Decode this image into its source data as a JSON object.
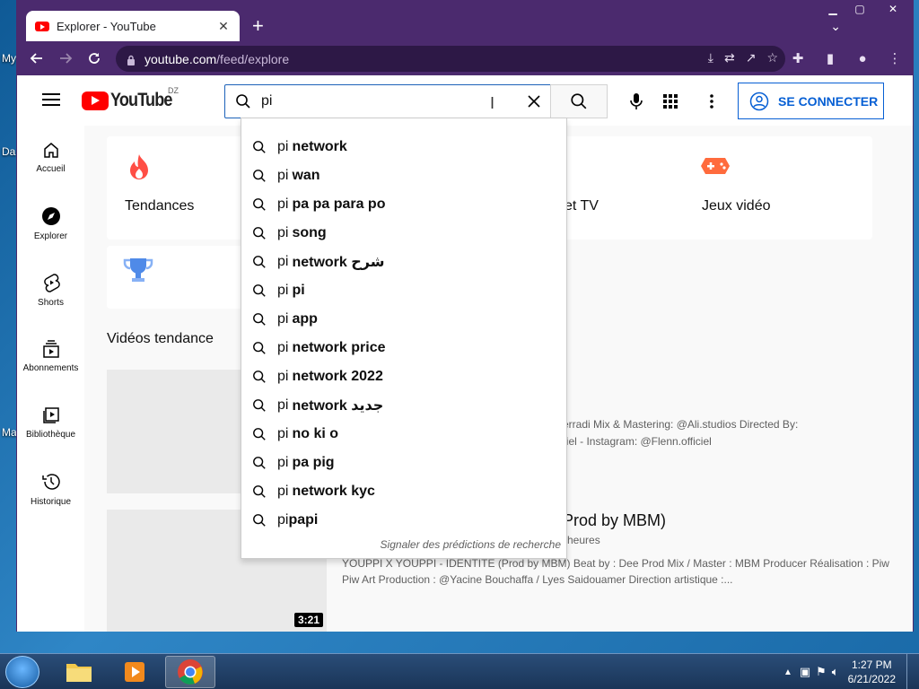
{
  "desktop": {
    "labels": [
      "My",
      "Da",
      "Ma"
    ]
  },
  "browser": {
    "tab_title": "Explorer - YouTube",
    "url_host": "youtube.com",
    "url_path": "/feed/explore",
    "accent": "#4b2a6e"
  },
  "youtube": {
    "logo_text": "YouTube",
    "country_code": "DZ",
    "search_value": "pi",
    "signin_label": "SE CONNECTER",
    "guide": [
      {
        "label": "Accueil",
        "icon": "home-icon"
      },
      {
        "label": "Explorer",
        "icon": "compass-icon"
      },
      {
        "label": "Shorts",
        "icon": "shorts-icon"
      },
      {
        "label": "Abonnements",
        "icon": "subscriptions-icon"
      },
      {
        "label": "Bibliothèque",
        "icon": "library-icon"
      },
      {
        "label": "Historique",
        "icon": "history-icon"
      }
    ],
    "cards": {
      "trending": "Tendances",
      "tv": "et TV",
      "gaming": "Jeux vidéo"
    },
    "section_title": "Vidéos tendance",
    "video1_desc_line1": "ilcherradi Mix & Mastering: @Ali.studios Directed By:",
    "video1_desc_line2": "officiel - Instagram: @Flenn.officiel",
    "video2_title": "(Prod by MBM)",
    "video2_meta": "heures",
    "video2_desc_line1": "YOUPPI X YOUPPI - IDENTITE (Prod by MBM) Beat by : Dee Prod Mix / Master : MBM Producer Réalisation : Piw",
    "video2_desc_line2": "Piw Art Production : @Yacine Bouchaffa / Lyes Saidouamer Direction artistique :...",
    "video2_duration": "3:21"
  },
  "suggestions": {
    "prefix": "pi",
    "items": [
      "network",
      "wan",
      "pa pa para po",
      "song",
      "network شرح",
      "pi",
      "app",
      "network price",
      "network 2022",
      "network جديد",
      "no ki o",
      "pa pig",
      "network kyc"
    ],
    "last_full": "pipapi",
    "last_prefix": "pi",
    "last_rest": "papi",
    "report_label": "Signaler des prédictions de recherche"
  },
  "taskbar": {
    "time": "1:27 PM",
    "date": "6/21/2022"
  }
}
